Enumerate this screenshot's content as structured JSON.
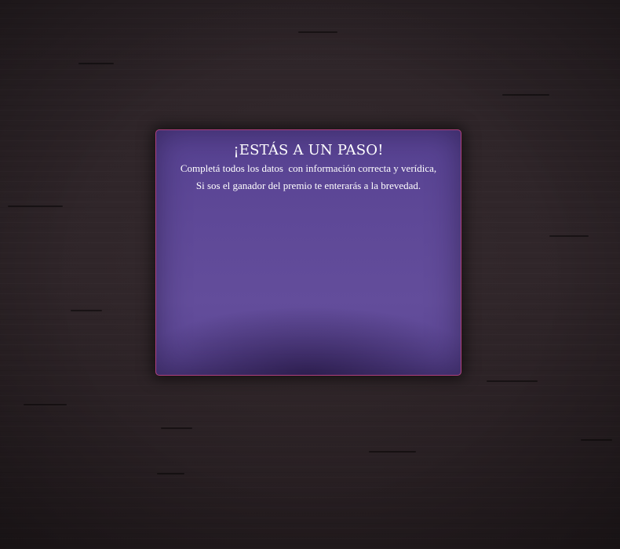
{
  "modal": {
    "title": "¡ESTÁS A UN PASO!",
    "line1": "Completá todos los datos  con información correcta y verídica,",
    "line2": "Si sos el ganador del premio te enterarás a la brevedad."
  },
  "colors": {
    "background": "#2a2124",
    "panel": "#5e4897",
    "panel_border": "#b0407e",
    "text": "#ffffff"
  }
}
